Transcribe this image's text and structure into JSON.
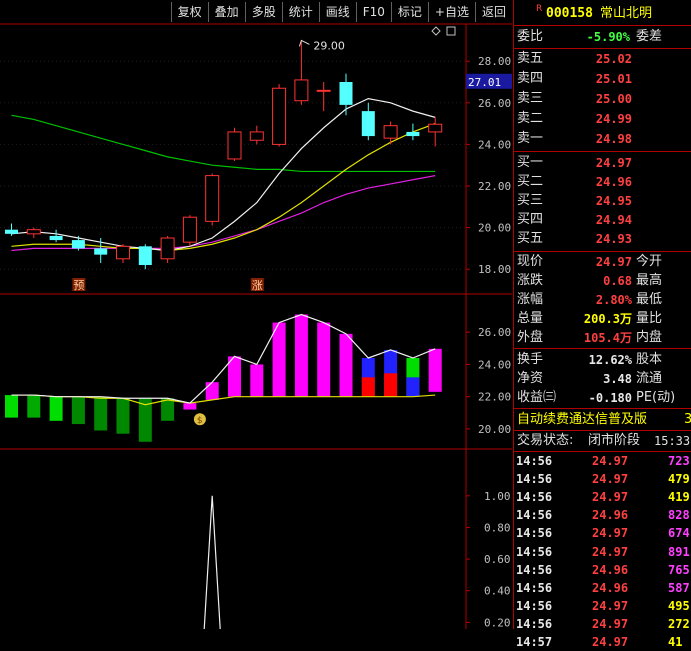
{
  "toolbar": {
    "buttons": [
      "复权",
      "叠加",
      "多股",
      "统计",
      "画线",
      "F10",
      "标记",
      "+自选",
      "返回"
    ]
  },
  "stock": {
    "badge": "R",
    "code": "000158",
    "name": "常山北明"
  },
  "order_book": {
    "ratio_label": "委比",
    "ratio_value": "-5.90%",
    "diff_label": "委差",
    "sells": [
      {
        "label": "卖五",
        "price": "25.02"
      },
      {
        "label": "卖四",
        "price": "25.01"
      },
      {
        "label": "卖三",
        "price": "25.00"
      },
      {
        "label": "卖二",
        "price": "24.99"
      },
      {
        "label": "卖一",
        "price": "24.98"
      }
    ],
    "buys": [
      {
        "label": "买一",
        "price": "24.97"
      },
      {
        "label": "买二",
        "price": "24.96"
      },
      {
        "label": "买三",
        "price": "24.95"
      },
      {
        "label": "买四",
        "price": "24.94"
      },
      {
        "label": "买五",
        "price": "24.93"
      }
    ]
  },
  "quote": [
    {
      "label": "现价",
      "value": "24.97",
      "color": "red",
      "label2": "今开"
    },
    {
      "label": "涨跌",
      "value": "0.68",
      "color": "red",
      "label2": "最高"
    },
    {
      "label": "涨幅",
      "value": "2.80%",
      "color": "red",
      "label2": "最低"
    },
    {
      "label": "总量",
      "value": "200.3万",
      "color": "yellow",
      "label2": "量比"
    },
    {
      "label": "外盘",
      "value": "105.4万",
      "color": "red",
      "label2": "内盘"
    }
  ],
  "stats": [
    {
      "label": "换手",
      "value": "12.62%",
      "label2": "股本"
    },
    {
      "label": "净资",
      "value": "3.48",
      "label2": "流通"
    },
    {
      "label": "收益㈢",
      "value": "-0.180",
      "label2": "PE(动)"
    }
  ],
  "banner": {
    "text": "自动续费通达信普及版",
    "num": "3"
  },
  "trade_state": {
    "label": "交易状态:",
    "value": "闭市阶段",
    "time": "15:33"
  },
  "ticks": [
    {
      "time": "14:56",
      "price": "24.97",
      "vol": "723",
      "vc": "#ff40ff"
    },
    {
      "time": "14:56",
      "price": "24.97",
      "vol": "479",
      "vc": "#ffff00"
    },
    {
      "time": "14:56",
      "price": "24.97",
      "vol": "419",
      "vc": "#ffff00"
    },
    {
      "time": "14:56",
      "price": "24.96",
      "vol": "828",
      "vc": "#ff40ff"
    },
    {
      "time": "14:56",
      "price": "24.97",
      "vol": "674",
      "vc": "#ff40ff"
    },
    {
      "time": "14:56",
      "price": "24.97",
      "vol": "891",
      "vc": "#ff40ff"
    },
    {
      "time": "14:56",
      "price": "24.96",
      "vol": "765",
      "vc": "#ff40ff"
    },
    {
      "time": "14:56",
      "price": "24.96",
      "vol": "587",
      "vc": "#ff40ff"
    },
    {
      "time": "14:56",
      "price": "24.97",
      "vol": "495",
      "vc": "#ffff00"
    },
    {
      "time": "14:56",
      "price": "24.97",
      "vol": "272",
      "vc": "#ffff00"
    },
    {
      "time": "14:57",
      "price": "24.97",
      "vol": "41",
      "vc": "#ffff00"
    }
  ],
  "chart_data": [
    {
      "type": "candlestick",
      "ylim": [
        17,
        29.5
      ],
      "y_ticks": [
        "28.00",
        "26.00",
        "24.00",
        "22.00",
        "20.00",
        "18.00"
      ],
      "current_price_label": "27.01",
      "high_label": "29.00",
      "markers": [
        "预",
        "涨"
      ],
      "candles": [
        {
          "o": 19.9,
          "h": 20.2,
          "l": 19.6,
          "c": 19.7
        },
        {
          "o": 19.7,
          "h": 20.0,
          "l": 19.5,
          "c": 19.9
        },
        {
          "o": 19.6,
          "h": 19.9,
          "l": 19.3,
          "c": 19.4
        },
        {
          "o": 19.4,
          "h": 19.6,
          "l": 18.9,
          "c": 19.0
        },
        {
          "o": 19.0,
          "h": 19.5,
          "l": 18.3,
          "c": 18.7
        },
        {
          "o": 18.5,
          "h": 19.2,
          "l": 18.3,
          "c": 19.1
        },
        {
          "o": 19.1,
          "h": 19.2,
          "l": 18.0,
          "c": 18.2
        },
        {
          "o": 18.5,
          "h": 19.6,
          "l": 18.3,
          "c": 19.5
        },
        {
          "o": 19.3,
          "h": 20.6,
          "l": 19.1,
          "c": 20.5
        },
        {
          "o": 20.3,
          "h": 22.6,
          "l": 20.1,
          "c": 22.5
        },
        {
          "o": 23.3,
          "h": 24.8,
          "l": 23.2,
          "c": 24.6
        },
        {
          "o": 24.2,
          "h": 24.9,
          "l": 24.0,
          "c": 24.6
        },
        {
          "o": 24.0,
          "h": 26.9,
          "l": 23.9,
          "c": 26.7
        },
        {
          "o": 26.1,
          "h": 29.0,
          "l": 25.9,
          "c": 27.1
        },
        {
          "o": 26.6,
          "h": 27.0,
          "l": 25.6,
          "c": 26.6
        },
        {
          "o": 27.0,
          "h": 27.4,
          "l": 25.4,
          "c": 25.9
        },
        {
          "o": 25.6,
          "h": 26.0,
          "l": 24.2,
          "c": 24.4
        },
        {
          "o": 24.3,
          "h": 25.1,
          "l": 24.0,
          "c": 24.9
        },
        {
          "o": 24.6,
          "h": 25.0,
          "l": 24.2,
          "c": 24.4
        },
        {
          "o": 24.6,
          "h": 25.3,
          "l": 23.9,
          "c": 24.97
        }
      ],
      "ma_white": [
        19.7,
        19.8,
        19.7,
        19.5,
        19.3,
        19.1,
        19.0,
        18.9,
        19.1,
        19.5,
        20.3,
        21.2,
        22.6,
        23.8,
        24.8,
        25.7,
        26.2,
        26.0,
        25.6,
        25.3
      ],
      "ma_yellow": [
        19.1,
        19.2,
        19.2,
        19.2,
        19.1,
        19.0,
        19.0,
        18.9,
        19.0,
        19.2,
        19.5,
        19.9,
        20.5,
        21.2,
        22.0,
        22.8,
        23.5,
        24.1,
        24.6,
        25.0
      ],
      "ma_green": [
        25.4,
        25.2,
        24.9,
        24.6,
        24.3,
        24.0,
        23.7,
        23.4,
        23.2,
        23.0,
        22.9,
        22.8,
        22.8,
        22.7,
        22.7,
        22.7,
        22.7,
        22.7,
        22.7,
        22.7
      ],
      "ma_purple": [
        18.9,
        19.0,
        19.0,
        19.0,
        19.0,
        19.0,
        19.0,
        19.0,
        19.1,
        19.3,
        19.6,
        19.9,
        20.3,
        20.7,
        21.2,
        21.6,
        21.9,
        22.1,
        22.3,
        22.5
      ]
    },
    {
      "type": "bar",
      "ylim": [
        19,
        28
      ],
      "y_ticks": [
        "26.00",
        "24.00",
        "22.00",
        "20.00"
      ],
      "bars": [
        {
          "lo": 20.7,
          "hi": 22.1,
          "color": "#00dd00"
        },
        {
          "lo": 20.7,
          "hi": 22.1,
          "color": "#00aa00"
        },
        {
          "lo": 20.5,
          "hi": 22.0,
          "color": "#00dd00"
        },
        {
          "lo": 20.3,
          "hi": 22.0,
          "color": "#008800"
        },
        {
          "lo": 19.9,
          "hi": 22.0,
          "color": "#008800"
        },
        {
          "lo": 19.7,
          "hi": 21.9,
          "color": "#008800"
        },
        {
          "lo": 19.2,
          "hi": 21.9,
          "color": "#008800"
        },
        {
          "lo": 20.5,
          "hi": 21.9,
          "color": "#008800"
        },
        {
          "lo": 21.2,
          "hi": 21.6,
          "color": "#ff00ff"
        },
        {
          "lo": 21.8,
          "hi": 22.9,
          "color": "#ff00ff"
        },
        {
          "lo": 22.0,
          "hi": 24.5,
          "color": "#ff00ff"
        },
        {
          "lo": 22.0,
          "hi": 24.0,
          "color": "#ff00ff"
        },
        {
          "lo": 22.0,
          "hi": 26.6,
          "color": "#ff00ff"
        },
        {
          "lo": 22.0,
          "hi": 27.1,
          "color": "#ff00ff"
        },
        {
          "lo": 22.0,
          "hi": 26.6,
          "color": "#ff00ff"
        },
        {
          "lo": 22.0,
          "hi": 25.9,
          "color": "#ff00ff"
        },
        {
          "lo": 22.0,
          "hi": 24.4,
          "color": "#2222ff",
          "inner": "#ff0000"
        },
        {
          "lo": 22.0,
          "hi": 24.9,
          "color": "#2222ff",
          "inner": "#ff0000"
        },
        {
          "lo": 22.0,
          "hi": 24.4,
          "color": "#00dd00",
          "inner": "#2222ff"
        },
        {
          "lo": 22.3,
          "hi": 24.97,
          "color": "#ff00ff"
        }
      ],
      "upper_line": [
        22.1,
        22.1,
        22.0,
        22.0,
        22.0,
        21.9,
        21.9,
        21.9,
        21.6,
        22.9,
        24.5,
        24.0,
        26.6,
        27.1,
        26.6,
        25.9,
        24.4,
        24.9,
        24.4,
        24.97
      ],
      "lower_line": [
        22.1,
        22.1,
        22.0,
        22.0,
        21.9,
        21.9,
        21.5,
        21.8,
        21.6,
        21.8,
        22.0,
        22.0,
        22.0,
        22.0,
        22.0,
        22.0,
        22.0,
        22.0,
        22.0,
        22.1
      ]
    },
    {
      "type": "line",
      "ylim": [
        0,
        1.1
      ],
      "y_ticks": [
        "1.00",
        "0.80",
        "0.60",
        "0.40",
        "0.20"
      ],
      "peak_index": 9,
      "values": [
        0,
        0,
        0,
        0,
        0,
        0,
        0,
        0,
        0,
        1.0,
        0,
        0,
        0,
        0,
        0,
        0,
        0,
        0,
        0,
        0
      ]
    }
  ]
}
